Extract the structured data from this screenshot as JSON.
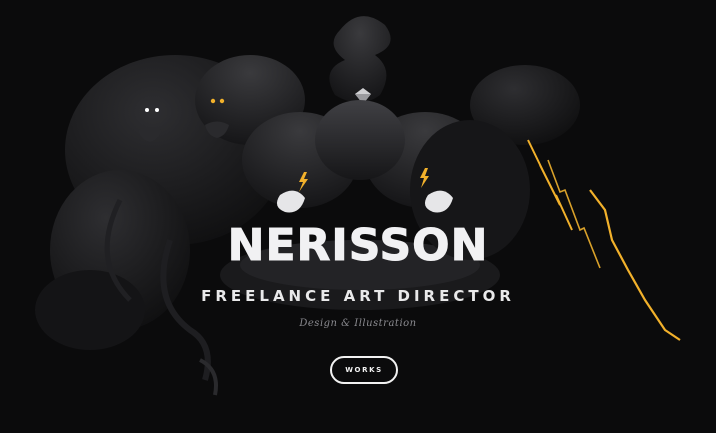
{
  "brand": {
    "logo_text": "NERISSON"
  },
  "hero": {
    "tagline": "FREELANCE ART DIRECTOR",
    "subtitle": "Design & Illustration"
  },
  "nav": {
    "works_label": "WORKS"
  },
  "colors": {
    "background": "#0b0b0c",
    "accent": "#f2b12b",
    "text": "#e9e9ea",
    "muted": "#8a8a8f"
  },
  "icons": [
    "lightning-bolt-icon",
    "diamond-icon"
  ]
}
